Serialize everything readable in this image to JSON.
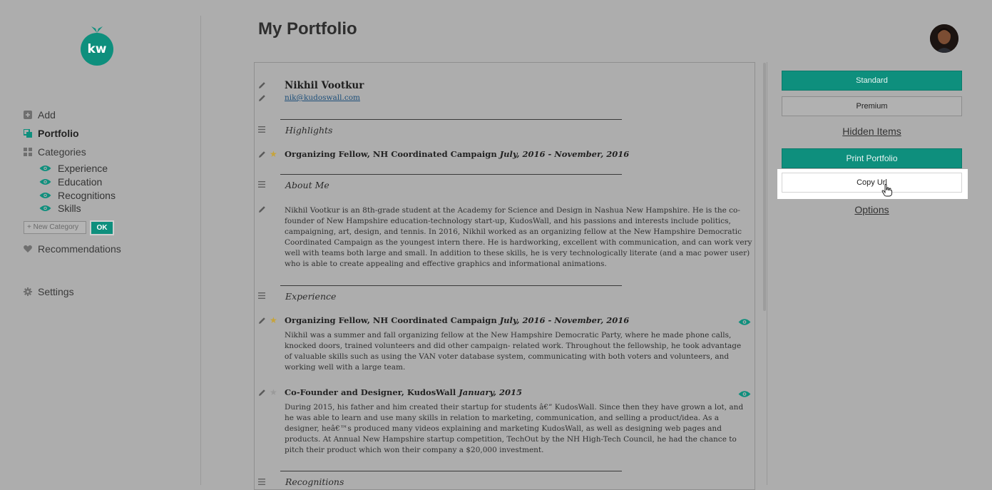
{
  "sidebar": {
    "logo_text": "kw",
    "nav": [
      {
        "label": "Add",
        "icon": "plus-square-icon"
      },
      {
        "label": "Portfolio",
        "icon": "portfolio-icon"
      },
      {
        "label": "Categories",
        "icon": "grid-icon"
      }
    ],
    "categories": [
      "Experience",
      "Education",
      "Recognitions",
      "Skills"
    ],
    "new_category_placeholder": "+ New Category",
    "ok_label": "OK",
    "recommendations_label": "Recommendations",
    "settings_label": "Settings"
  },
  "header": {
    "title": "My Portfolio",
    "avatar_icon": "user-avatar"
  },
  "portfolio": {
    "name": "Nikhil Vootkur",
    "email": "nik@kudoswall.com",
    "sections": {
      "highlights": "Highlights",
      "about": "About Me",
      "experience": "Experience",
      "recognitions": "Recognitions"
    },
    "highlight_entry": {
      "title": "Organizing Fellow, NH Coordinated Campaign",
      "date": "July, 2016 - November, 2016"
    },
    "about_text": "Nikhil Vootkur is an 8th-grade student at the Academy for Science and Design in Nashua New Hampshire. He is the co-founder of New Hampshire education-technology start-up, KudosWall, and his passions and interests include politics, campaigning, art, design, and tennis. In 2016, Nikhil worked as an organizing fellow at the New Hampshire Democratic Coordinated Campaign as the youngest intern there. He is hardworking, excellent with communication, and can work very well with teams both large and small. In addition to these skills, he is very technologically literate (and a mac power user) who is able to create appealing and effective graphics and informational animations.",
    "experience": [
      {
        "title": "Organizing Fellow, NH Coordinated Campaign",
        "date": "July, 2016 - November, 2016",
        "starred": true,
        "text": "Nikhil was a summer and fall organizing fellow at the New Hampshire Democratic Party, where he made phone calls, knocked doors, trained volunteers and did other campaign- related work. Throughout the fellowship, he took advantage of valuable skills such as using the VAN voter database system, communicating with both voters and volunteers, and working well with a large team."
      },
      {
        "title": "Co-Founder and Designer, KudosWall",
        "date": "January, 2015",
        "starred": false,
        "text": "During 2015, his father and him created their startup for students â€” KudosWall. Since then they have grown a lot, and he was able to learn and use many skills in relation to marketing, communication, and selling a product/idea. As a designer, heâ€™s produced many videos explaining and marketing KudosWall, as well as designing web pages and products. At Annual New Hampshire startup competition, TechOut by the NH High-Tech Council, he had the chance to pitch their product which won their company a $20,000 investment."
      }
    ]
  },
  "controls": {
    "standard_label": "Standard",
    "premium_label": "Premium",
    "hidden_items_label": "Hidden Items",
    "print_label": "Print Portfolio",
    "copy_url_label": "Copy Url",
    "options_label": "Options"
  },
  "colors": {
    "accent": "#0e8f7d",
    "background": "#adadad",
    "star": "#c7a43a"
  }
}
